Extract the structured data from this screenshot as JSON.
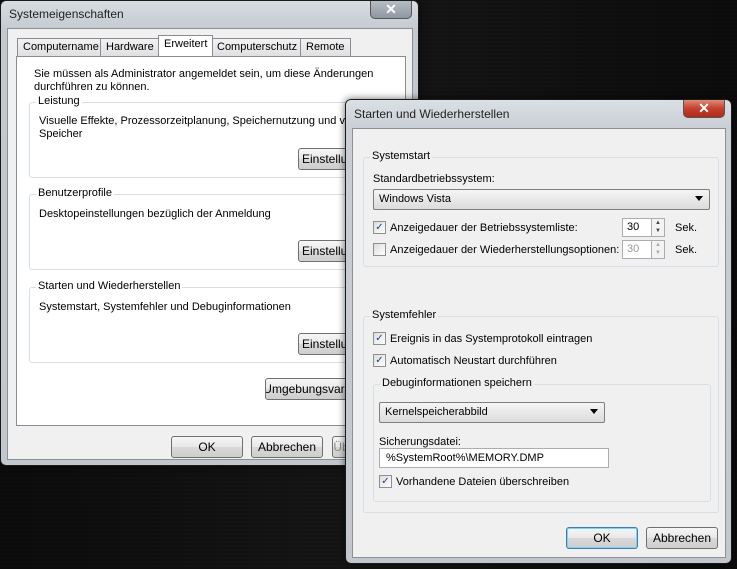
{
  "sys": {
    "title": "Systemeigenschaften",
    "close": "✕",
    "tabs": [
      "Computername",
      "Hardware",
      "Erweitert",
      "Computerschutz",
      "Remote"
    ],
    "admin_note": "Sie müssen als Administrator angemeldet sein, um diese Änderungen\ndurchführen zu können.",
    "groups": [
      {
        "label": "Leistung",
        "desc": "Visuelle Effekte, Prozessorzeitplanung, Speichernutzung und virtu\nSpeicher",
        "button": "Einstellungen..."
      },
      {
        "label": "Benutzerprofile",
        "desc": "Desktopeinstellungen bezüglich der Anmeldung",
        "button": "Einstellungen..."
      },
      {
        "label": "Starten und Wiederherstellen",
        "desc": "Systemstart, Systemfehler und Debuginformationen",
        "button": "Einstellungen..."
      }
    ],
    "env_button": "Umgebungsvariablen...",
    "ok": "OK",
    "cancel": "Abbrechen",
    "apply": "Übernehmen"
  },
  "sr": {
    "title": "Starten und Wiederherstellen",
    "close": "✕",
    "systemstart": {
      "label": "Systemstart",
      "default_os_label": "Standardbetriebssystem:",
      "default_os_value": "Windows Vista",
      "show_list_label": "Anzeigedauer der Betriebssystemliste:",
      "show_list_checked": true,
      "show_list_value": "30",
      "show_recovery_label": "Anzeigedauer der Wiederherstellungsoptionen:",
      "show_recovery_checked": false,
      "show_recovery_value": "30",
      "unit": "Sek."
    },
    "systemfehler": {
      "label": "Systemfehler",
      "log_event_label": "Ereignis in das Systemprotokoll eintragen",
      "log_event_checked": true,
      "auto_restart_label": "Automatisch Neustart durchführen",
      "auto_restart_checked": true,
      "debug": {
        "label": "Debuginformationen speichern",
        "type_value": "Kernelspeicherabbild",
        "file_label": "Sicherungsdatei:",
        "file_value": "%SystemRoot%\\MEMORY.DMP",
        "overwrite_label": "Vorhandene Dateien überschreiben",
        "overwrite_checked": true
      }
    },
    "ok": "OK",
    "cancel": "Abbrechen"
  },
  "icons": {
    "check": "✓",
    "spin_up": "▲",
    "spin_down": "▼"
  },
  "colors": {
    "close_red": "#c4412f",
    "close_grey": "#8f97a0",
    "glass": "#c3c9cf"
  }
}
